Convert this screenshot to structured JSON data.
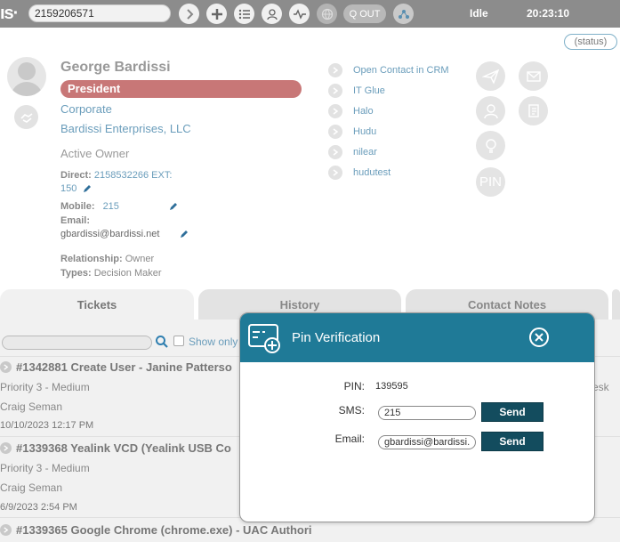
{
  "topbar": {
    "logo_text": "ıs·",
    "phone_value": "2159206571",
    "qout_label": "Q OUT",
    "status": "Idle",
    "time": "20:23:10",
    "icons": [
      "chevron-right-icon",
      "plus-icon",
      "list-icon",
      "user-icon",
      "pulse-icon",
      "globe-icon",
      "q-out-button",
      "network-icon"
    ]
  },
  "status_pill": "(status)",
  "contact": {
    "name": "George Bardissi",
    "title": "President",
    "type": "Corporate",
    "company": "Bardissi Enterprises, LLC",
    "role": "Active Owner",
    "direct_label": "Direct:",
    "direct_value_1": "2158532266 EXT:",
    "direct_value_2": "150",
    "mobile_label": "Mobile:",
    "mobile_value": "215",
    "email_label": "Email:",
    "email_value": "gbardissi@bardissi.net",
    "relationship_label": "Relationship:",
    "relationship_value": "Owner",
    "types_label": "Types:",
    "types_value": "Decision Maker"
  },
  "links": [
    {
      "label": "Open Contact in CRM"
    },
    {
      "label": "IT Glue"
    },
    {
      "label": "Halo"
    },
    {
      "label": "Hudu"
    },
    {
      "label": "nilear"
    },
    {
      "label": "hudutest"
    }
  ],
  "action_buttons": {
    "pin_label": "PIN"
  },
  "tabs": [
    {
      "label": "Tickets"
    },
    {
      "label": "History"
    },
    {
      "label": "Contact Notes"
    }
  ],
  "tickets_panel": {
    "show_only_label": "Show only",
    "right_partial": "esk",
    "tickets": [
      {
        "title": "#1342881 Create User - Janine Patterso",
        "priority": "Priority 3 - Medium",
        "owner": "Craig Seman",
        "date": "10/10/2023 12:17 PM"
      },
      {
        "title": "#1339368 Yealink VCD (Yealink USB Co",
        "priority": "Priority 3 - Medium",
        "owner": "Craig Seman",
        "date": "6/9/2023 2:54 PM"
      },
      {
        "title": "#1339365 Google Chrome (chrome.exe) - UAC Authori",
        "priority": "",
        "owner": "",
        "date": ""
      }
    ]
  },
  "modal": {
    "title": "Pin Verification",
    "pin_label": "PIN:",
    "pin_value": "139595",
    "sms_label": "SMS:",
    "sms_value": "215",
    "email_label": "Email:",
    "email_value": "gbardissi@bardissi.net",
    "send_label": "Send"
  },
  "colors": {
    "topbar": "#8c8c8c",
    "title_bar": "#c87777",
    "link": "#6a9dbb",
    "modal_header": "#1f7a97",
    "send_button": "#134c5e"
  }
}
